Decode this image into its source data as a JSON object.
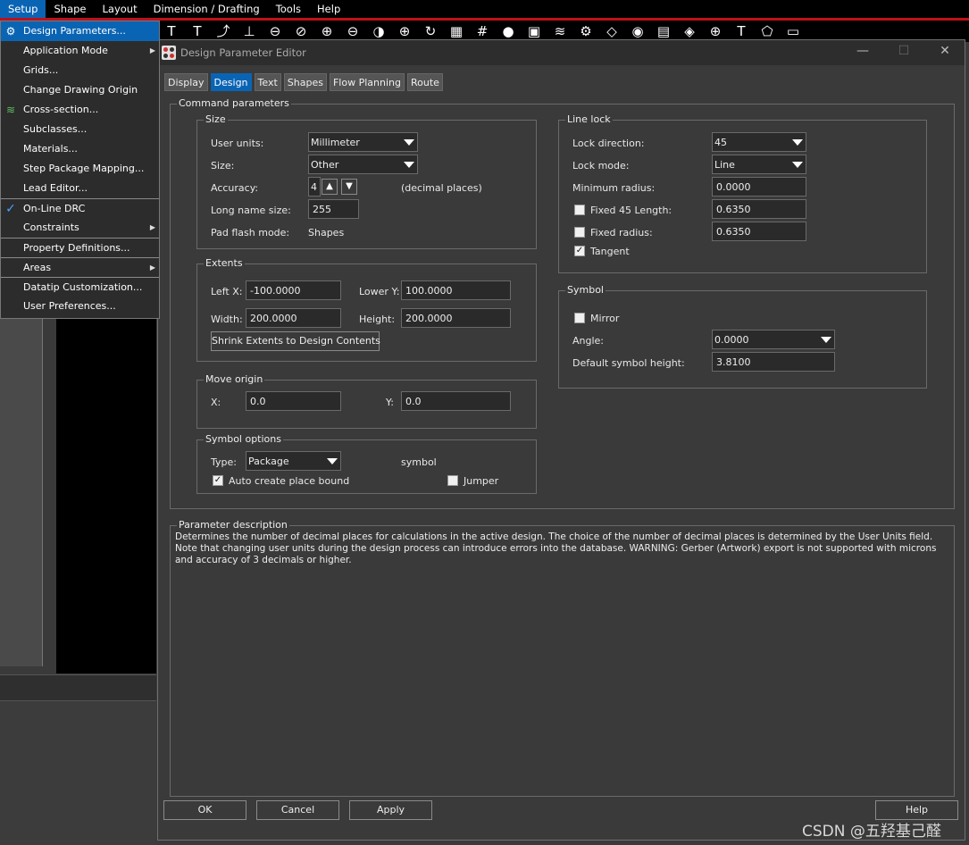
{
  "menubar": [
    "Setup",
    "Shape",
    "Layout",
    "Dimension / Drafting",
    "Tools",
    "Help"
  ],
  "setup_menu": {
    "items": [
      {
        "label": "Design Parameters...",
        "icon": "gear-icon",
        "highlight": true
      },
      {
        "label": "Application Mode",
        "submenu": true
      },
      {
        "label": "Grids..."
      },
      {
        "label": "Change Drawing Origin"
      },
      {
        "label": "Cross-section...",
        "icon": "layers-icon"
      },
      {
        "label": "Subclasses..."
      },
      {
        "label": "Materials..."
      },
      {
        "label": "Step Package Mapping..."
      },
      {
        "label": "Lead Editor..."
      },
      {
        "label": "On-Line DRC",
        "checked": true,
        "separator": true
      },
      {
        "label": "Constraints",
        "submenu": true
      },
      {
        "label": "Property Definitions...",
        "separator": true
      },
      {
        "label": "Areas",
        "submenu": true,
        "separator": true
      },
      {
        "label": "Datatip Customization...",
        "separator": true
      },
      {
        "label": "User Preferences..."
      }
    ]
  },
  "dialog": {
    "title": "Design Parameter Editor",
    "tabs": [
      "Display",
      "Design",
      "Text",
      "Shapes",
      "Flow Planning",
      "Route"
    ],
    "active_tab": "Design",
    "command_parameters_title": "Command parameters",
    "size": {
      "title": "Size",
      "user_units_label": "User units:",
      "user_units_value": "Millimeter",
      "size_label": "Size:",
      "size_value": "Other",
      "accuracy_label": "Accuracy:",
      "accuracy_value": "4",
      "accuracy_note": "(decimal places)",
      "long_name_label": "Long name size:",
      "long_name_value": "255",
      "pad_flash_label": "Pad flash mode:",
      "pad_flash_value": "Shapes"
    },
    "extents": {
      "title": "Extents",
      "left_x_label": "Left X:",
      "left_x_value": "-100.0000",
      "lower_y_label": "Lower Y:",
      "lower_y_value": "100.0000",
      "width_label": "Width:",
      "width_value": "200.0000",
      "height_label": "Height:",
      "height_value": "200.0000",
      "shrink_button": "Shrink Extents to Design Contents"
    },
    "move_origin": {
      "title": "Move origin",
      "x_label": "X:",
      "x_value": "0.0",
      "y_label": "Y:",
      "y_value": "0.0"
    },
    "symbol_options": {
      "title": "Symbol options",
      "type_label": "Type:",
      "type_value": "Package",
      "type_note": "symbol",
      "auto_bound_label": "Auto create place bound",
      "auto_bound_checked": true,
      "jumper_label": "Jumper",
      "jumper_checked": false
    },
    "line_lock": {
      "title": "Line lock",
      "lock_direction_label": "Lock direction:",
      "lock_direction_value": "45",
      "lock_mode_label": "Lock mode:",
      "lock_mode_value": "Line",
      "min_radius_label": "Minimum radius:",
      "min_radius_value": "0.0000",
      "fixed45_label": "Fixed 45 Length:",
      "fixed45_value": "0.6350",
      "fixed45_checked": false,
      "fixed_radius_label": "Fixed radius:",
      "fixed_radius_value": "0.6350",
      "fixed_radius_checked": false,
      "tangent_label": "Tangent",
      "tangent_checked": true
    },
    "symbol": {
      "title": "Symbol",
      "mirror_label": "Mirror",
      "mirror_checked": false,
      "angle_label": "Angle:",
      "angle_value": "0.0000",
      "default_height_label": "Default symbol height:",
      "default_height_value": "3.8100"
    },
    "description": {
      "title": "Parameter description",
      "text": "Determines the number of decimal places for calculations in the active design. The choice of the number of decimal places is determined by the User Units field. Note that changing user units during the design process can introduce errors into the database. WARNING: Gerber (Artwork) export is not supported with microns and accuracy of 3 decimals or higher."
    },
    "buttons": {
      "ok": "OK",
      "cancel": "Cancel",
      "apply": "Apply",
      "help": "Help"
    }
  },
  "watermark": "CSDN @五羟基己醛",
  "colors": {
    "highlight": "#0a64b4",
    "red_line": "#c0101a"
  }
}
